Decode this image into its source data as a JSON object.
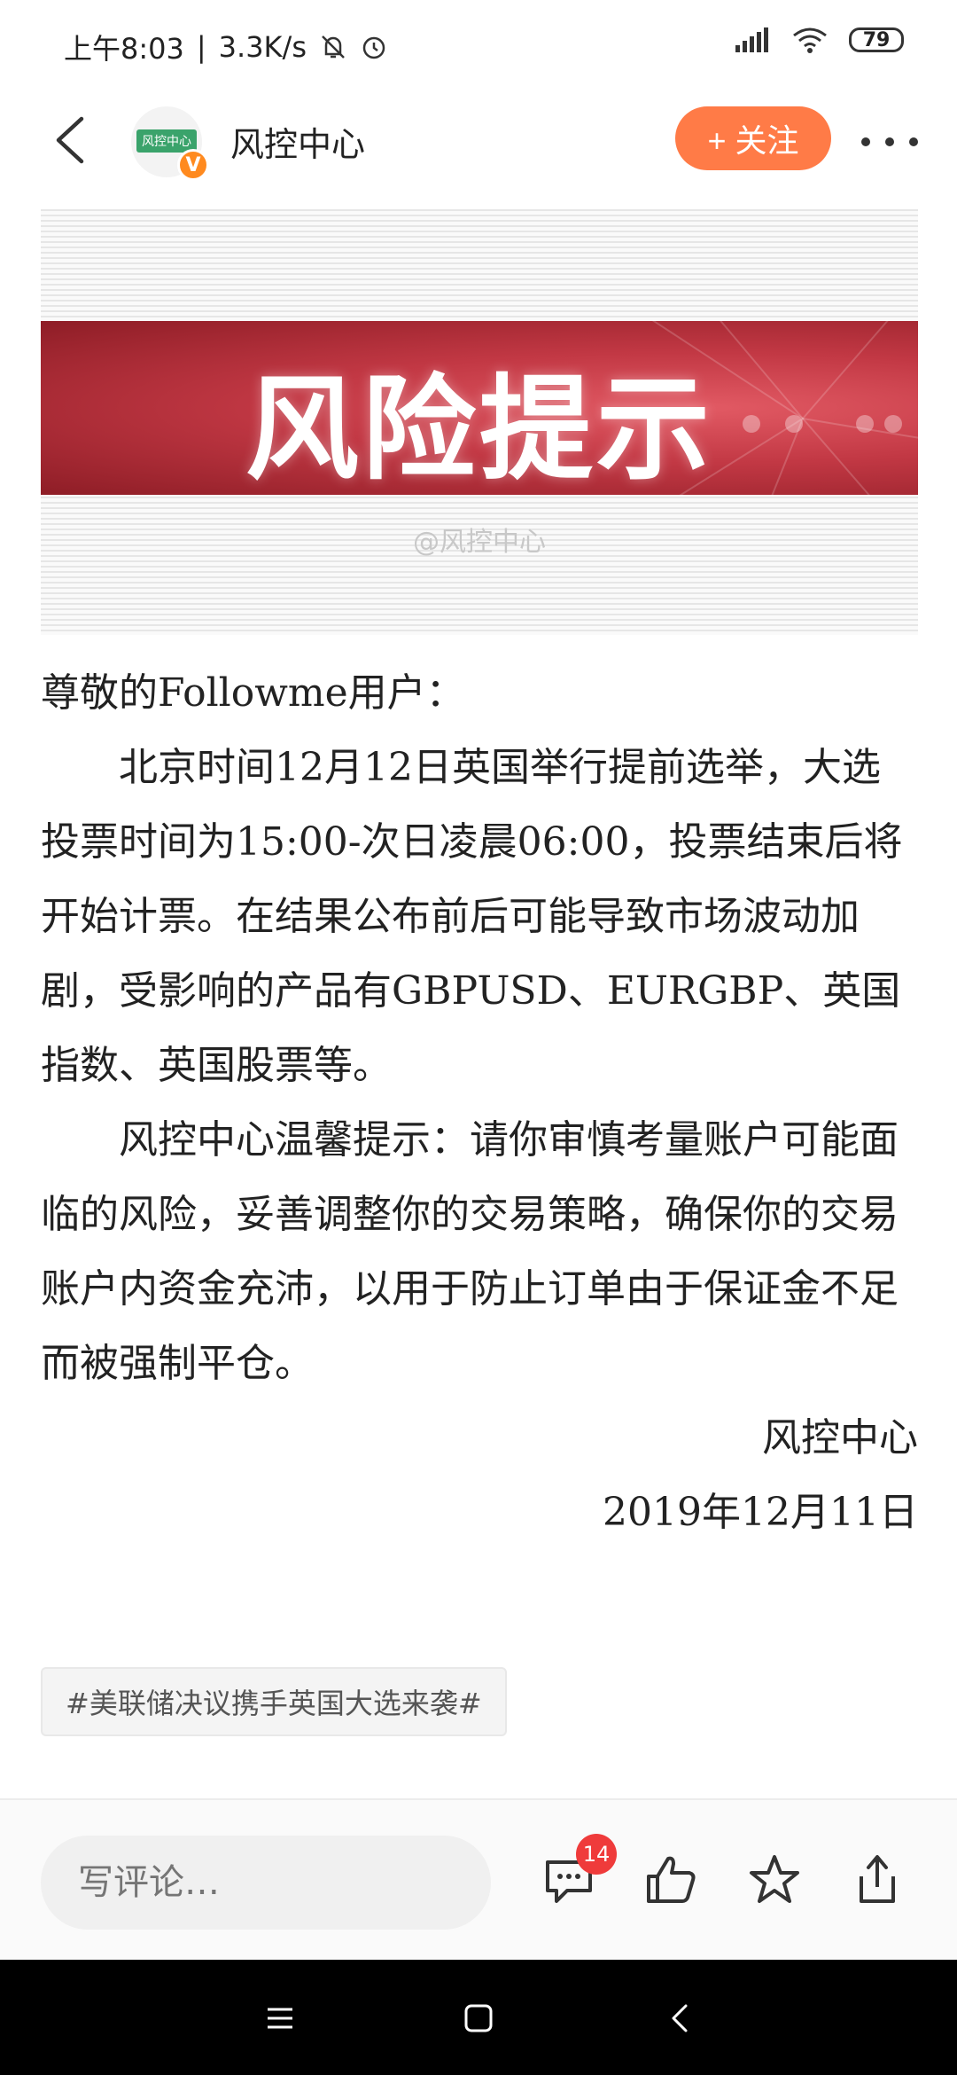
{
  "status": {
    "time": "上午8:03",
    "speed": "3.3K/s",
    "battery": "79"
  },
  "header": {
    "avatar_text": "风控中心",
    "avatar_badge": "V",
    "name": "风控中心",
    "follow_label": "+ 关注"
  },
  "banner": {
    "title": "风险提示",
    "watermark": "@风控中心"
  },
  "article": {
    "greeting": "尊敬的Followme用户：",
    "p1": "北京时间12月12日英国举行提前选举，大选投票时间为15:00-次日凌晨06:00，投票结束后将开始计票。在结果公布前后可能导致市场波动加剧，受影响的产品有GBPUSD、EURGBP、英国指数、英国股票等。",
    "p2": "风控中心温馨提示：请你审慎考量账户可能面临的风险，妥善调整你的交易策略，确保你的交易账户内资金充沛，以用于防止订单由于保证金不足而被强制平仓。",
    "signature": "风控中心",
    "date": "2019年12月11日"
  },
  "topic_tag": "#美联储决议携手英国大选来袭#",
  "bottombar": {
    "comment_placeholder": "写评论…",
    "comment_count": "14"
  },
  "colors": {
    "accent": "#ff7b47",
    "badge": "#ef3b3b",
    "banner_red": "#c23844"
  }
}
